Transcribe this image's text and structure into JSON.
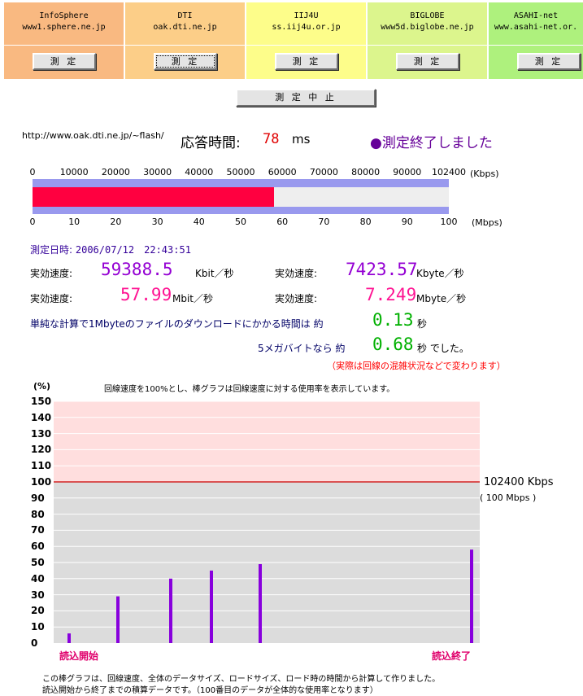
{
  "providers": [
    {
      "name": "InfoSphere",
      "host": "www1.sphere.ne.jp",
      "color": "#f9b981",
      "button": "測 定",
      "active": false
    },
    {
      "name": "DTI",
      "host": "oak.dti.ne.jp",
      "color": "#fcce88",
      "button": "測 定",
      "active": true
    },
    {
      "name": "IIJ4U",
      "host": "ss.iij4u.or.jp",
      "color": "#fdfd8a",
      "button": "測 定",
      "active": false
    },
    {
      "name": "BIGLOBE",
      "host": "www5d.biglobe.ne.jp",
      "color": "#dcf58d",
      "button": "測 定",
      "active": false
    },
    {
      "name": "ASAHI-net",
      "host": "www.asahi-net.or.",
      "color": "#aef17d",
      "button": "測 定",
      "active": false
    }
  ],
  "stop_button": "測 定 中 止",
  "status": {
    "url": "http://www.oak.dti.ne.jp/~flash/",
    "response_label": "応答時間:",
    "response_value": "78",
    "response_unit": "ms",
    "done_text": "●測定終了しました"
  },
  "progress": {
    "kbps_ticks": [
      "0",
      "10000",
      "20000",
      "30000",
      "40000",
      "50000",
      "60000",
      "70000",
      "80000",
      "90000",
      "102400"
    ],
    "kbps_unit": "(Kbps)",
    "mbps_ticks": [
      "0",
      "10",
      "20",
      "30",
      "40",
      "50",
      "60",
      "70",
      "80",
      "90",
      "100"
    ],
    "mbps_unit": "(Mbps)",
    "fraction": 0.58,
    "fill_color": "#ff0040"
  },
  "results": {
    "date_label": "測定日時:",
    "date_value": "2006/07/12　22:43:51",
    "eff_label": "実効速度:",
    "kbit_value": "59388.5",
    "kbit_unit": "Kbit／秒",
    "kbyte_value": "7423.57",
    "kbyte_unit": "Kbyte／秒",
    "mbit_value": "57.99",
    "mbit_unit": "Mbit／秒",
    "mbyte_value": "7.249",
    "mbyte_unit": "Mbyte／秒",
    "dl1_label": "単純な計算で1Mbyteのファイルのダウンロードにかかる時間は 約",
    "dl1_value": "0.13",
    "dl1_unit": "秒",
    "dl5_label": "5メガバイトなら 約",
    "dl5_value": "0.68",
    "dl5_unit": "秒 でした。",
    "note": "（実際は回線の混雑状況などで変わります）"
  },
  "chart_caption": "回線速度を100%とし、棒グラフは回線速度に対する使用率を表示しています。",
  "chart_data": {
    "type": "bar",
    "ylabel": "(%)",
    "yticks": [
      150,
      140,
      130,
      120,
      110,
      100,
      90,
      80,
      70,
      60,
      50,
      40,
      30,
      20,
      10,
      0
    ],
    "ylim": [
      0,
      150
    ],
    "reference_line": {
      "value": 100,
      "label": "102400 Kbps",
      "sublabel": "( 100 Mbps )"
    },
    "x": [
      1,
      13,
      26,
      36,
      48,
      100
    ],
    "xlim": [
      0,
      102
    ],
    "values": [
      6,
      29,
      40,
      45,
      49,
      58
    ],
    "bar_color": "#8800dd",
    "start_label": "読込開始",
    "end_label": "読込終了"
  },
  "footer": {
    "line1": "この棒グラフは、回線速度、全体のデータサイズ、ロードサイズ、ロード時の時間から計算して作りました。",
    "line2": "読込開始から終了までの積算データです。（100番目のデータが全体的な使用率となります）"
  }
}
